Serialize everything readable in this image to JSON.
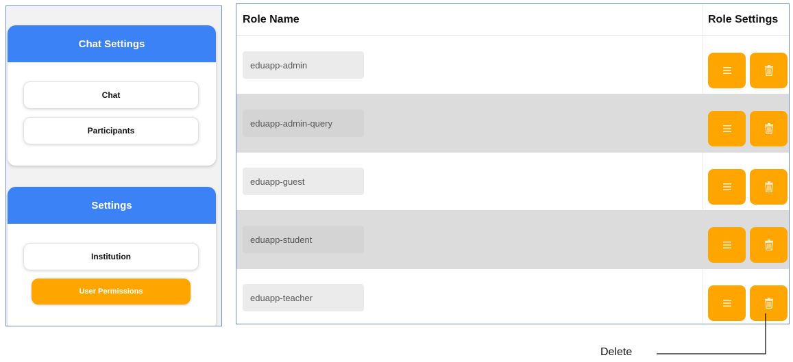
{
  "sidebar": {
    "chat_settings": {
      "title": "Chat Settings",
      "items": [
        {
          "label": "Chat"
        },
        {
          "label": "Participants"
        }
      ]
    },
    "settings": {
      "title": "Settings",
      "items": [
        {
          "label": "Institution"
        },
        {
          "label": "User Permissions",
          "active": true
        }
      ]
    }
  },
  "table": {
    "headers": {
      "role_name": "Role Name",
      "role_settings": "Role Settings"
    },
    "rows": [
      {
        "role": "eduapp-admin"
      },
      {
        "role": "eduapp-admin-query"
      },
      {
        "role": "eduapp-guest"
      },
      {
        "role": "eduapp-student"
      },
      {
        "role": "eduapp-teacher"
      }
    ],
    "action_icons": [
      "menu-icon",
      "trash-icon"
    ]
  },
  "annotation": {
    "label": "Delete"
  },
  "colors": {
    "header_blue": "#3b82f6",
    "accent_orange": "#ffa500",
    "row_shade": "#dcdcdc"
  }
}
